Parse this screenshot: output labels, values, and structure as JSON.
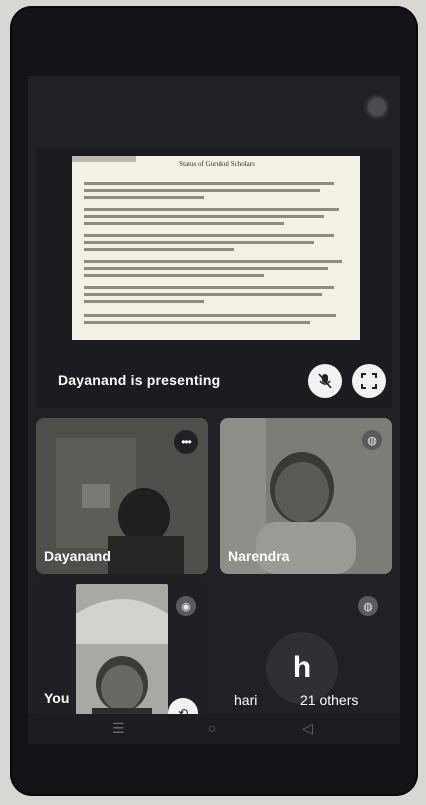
{
  "presentation": {
    "caption": "Dayanand is presenting",
    "slide_title": "Status of Gurukul Scholars",
    "mute_icon": "mic-off-icon",
    "fullscreen_icon": "fullscreen-icon"
  },
  "participants": [
    {
      "name": "Dayanand",
      "icon": "more-options-icon"
    },
    {
      "name": "Narendra",
      "icon": "mic-icon"
    }
  ],
  "self_view": {
    "name": "You",
    "icon": "more-options-icon"
  },
  "others": {
    "initial": "h",
    "name": "hari",
    "count_label": "21 others"
  },
  "colors": {
    "background": "#202124",
    "text": "#ffffff",
    "button": "#f2f2f2"
  }
}
